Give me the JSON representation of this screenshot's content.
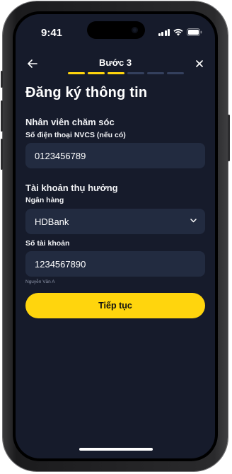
{
  "status_bar": {
    "time": "9:41"
  },
  "header": {
    "step_title": "Bước 3",
    "steps_total": 6,
    "steps_done": 3
  },
  "page_title": "Đăng ký thông tin",
  "care_staff": {
    "section_title": "Nhân viên chăm sóc",
    "phone_label": "Số điện thoại NVCS (nếu có)",
    "phone_value": "0123456789"
  },
  "beneficiary": {
    "section_title": "Tài khoản thụ hưởng",
    "bank_label": "Ngân hàng",
    "bank_value": "HDBank",
    "account_label": "Số tài khoản",
    "account_value": "1234567890",
    "account_holder": "Nguyễn Văn A"
  },
  "continue_button": "Tiếp tục",
  "colors": {
    "accent": "#ffd50d",
    "background": "#161b2b",
    "field": "#222b40"
  },
  "icons": {
    "back": "arrow-left-icon",
    "close": "close-icon",
    "dropdown": "chevron-down-icon"
  }
}
